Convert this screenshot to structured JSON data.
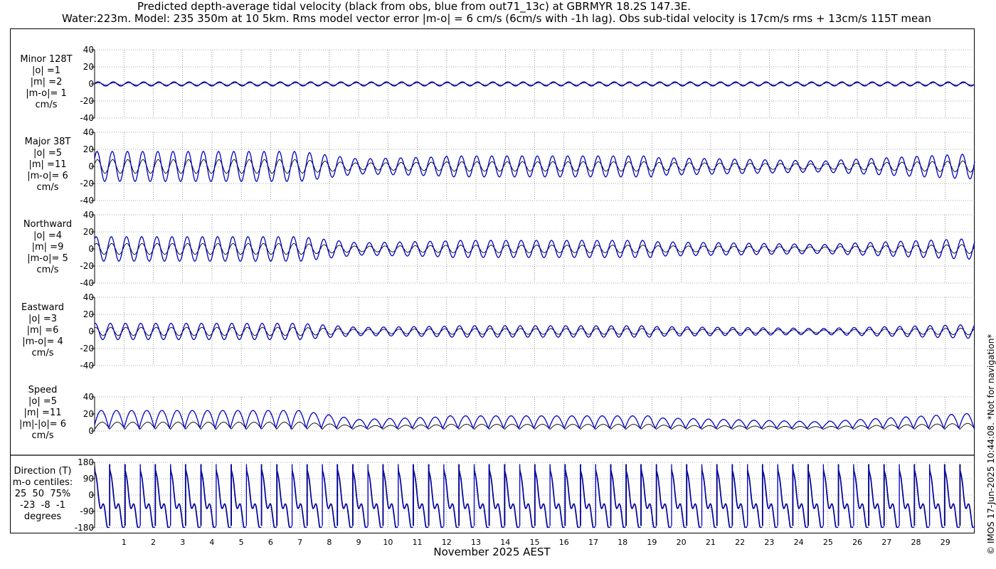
{
  "header": {
    "title_line1": "Predicted depth-average tidal velocity (black from obs, blue from out71_13c) at GBRMYR 18.2S 147.3E.",
    "title_line2": "Water:223m. Model: 235 350m at 10 5km. Rms model vector error |m-o| = 6 cm/s (6cm/s with -1h lag). Obs sub-tidal velocity is 17cm/s rms + 13cm/s 115T mean"
  },
  "footer": {
    "xlabel": "November 2025 AEST",
    "copyright": "© IMOS 17-Jun-2025 10:44:08. *Not for navigation*"
  },
  "colors": {
    "obs": "#000000",
    "model": "#0000c8",
    "grid": "#555555"
  },
  "chart_data": [
    {
      "type": "line",
      "panel": "minor",
      "label": "Minor 128T\n|o| =1\n|m| =2\n|m-o|= 1\ncm/s",
      "yticks": [
        "40",
        "20",
        "0",
        "-20",
        "-40"
      ],
      "ylim": [
        -40,
        40
      ],
      "xlim": [
        0,
        30
      ],
      "series": [
        {
          "name": "obs",
          "amplitude_cm_s": 1
        },
        {
          "name": "model",
          "amplitude_cm_s": 2
        }
      ]
    },
    {
      "type": "line",
      "panel": "major",
      "label": "Major 38T\n|o| =5\n|m| =11\n|m-o|= 6\ncm/s",
      "yticks": [
        "40",
        "20",
        "0",
        "-20",
        "-40"
      ],
      "ylim": [
        -40,
        40
      ],
      "xlim": [
        0,
        30
      ],
      "series": [
        {
          "name": "obs",
          "amplitude_cm_s": 5
        },
        {
          "name": "model",
          "amplitude_cm_s": 11
        }
      ]
    },
    {
      "type": "line",
      "panel": "northward",
      "label": "Northward\n|o| =4\n|m| =9\n|m-o|= 5\ncm/s",
      "yticks": [
        "40",
        "20",
        "0",
        "-20",
        "-40"
      ],
      "ylim": [
        -40,
        40
      ],
      "xlim": [
        0,
        30
      ],
      "series": [
        {
          "name": "obs",
          "amplitude_cm_s": 4
        },
        {
          "name": "model",
          "amplitude_cm_s": 9
        }
      ]
    },
    {
      "type": "line",
      "panel": "eastward",
      "label": "Eastward\n|o| =3\n|m| =6\n|m-o|= 4\ncm/s",
      "yticks": [
        "40",
        "20",
        "0",
        "-20",
        "-40"
      ],
      "ylim": [
        -40,
        40
      ],
      "xlim": [
        0,
        30
      ],
      "series": [
        {
          "name": "obs",
          "amplitude_cm_s": 3
        },
        {
          "name": "model",
          "amplitude_cm_s": 6
        }
      ]
    },
    {
      "type": "line",
      "panel": "speed",
      "label": "Speed\n|o| =5\n|m| =11\n|m|-|o|= 6\ncm/s",
      "yticks": [
        "40",
        "20",
        "0"
      ],
      "ylim": [
        0,
        40
      ],
      "xlim": [
        0,
        30
      ],
      "series": [
        {
          "name": "obs",
          "amplitude_cm_s": 5
        },
        {
          "name": "model",
          "amplitude_cm_s": 11
        }
      ]
    },
    {
      "type": "line",
      "panel": "direction",
      "label": "Direction (T)\nm-o centiles:\n25  50  75%\n-23  -8  -1\ndegrees",
      "yticks": [
        "180",
        "90",
        "0",
        "-90",
        "-180"
      ],
      "ylim": [
        -180,
        180
      ],
      "xlim": [
        0,
        30
      ],
      "series": [
        {
          "name": "obs"
        },
        {
          "name": "model"
        }
      ]
    }
  ],
  "xticks": [
    "1",
    "2",
    "3",
    "4",
    "5",
    "6",
    "7",
    "8",
    "9",
    "10",
    "11",
    "12",
    "13",
    "14",
    "15",
    "16",
    "17",
    "18",
    "19",
    "20",
    "21",
    "22",
    "23",
    "24",
    "25",
    "26",
    "27",
    "28",
    "29"
  ]
}
